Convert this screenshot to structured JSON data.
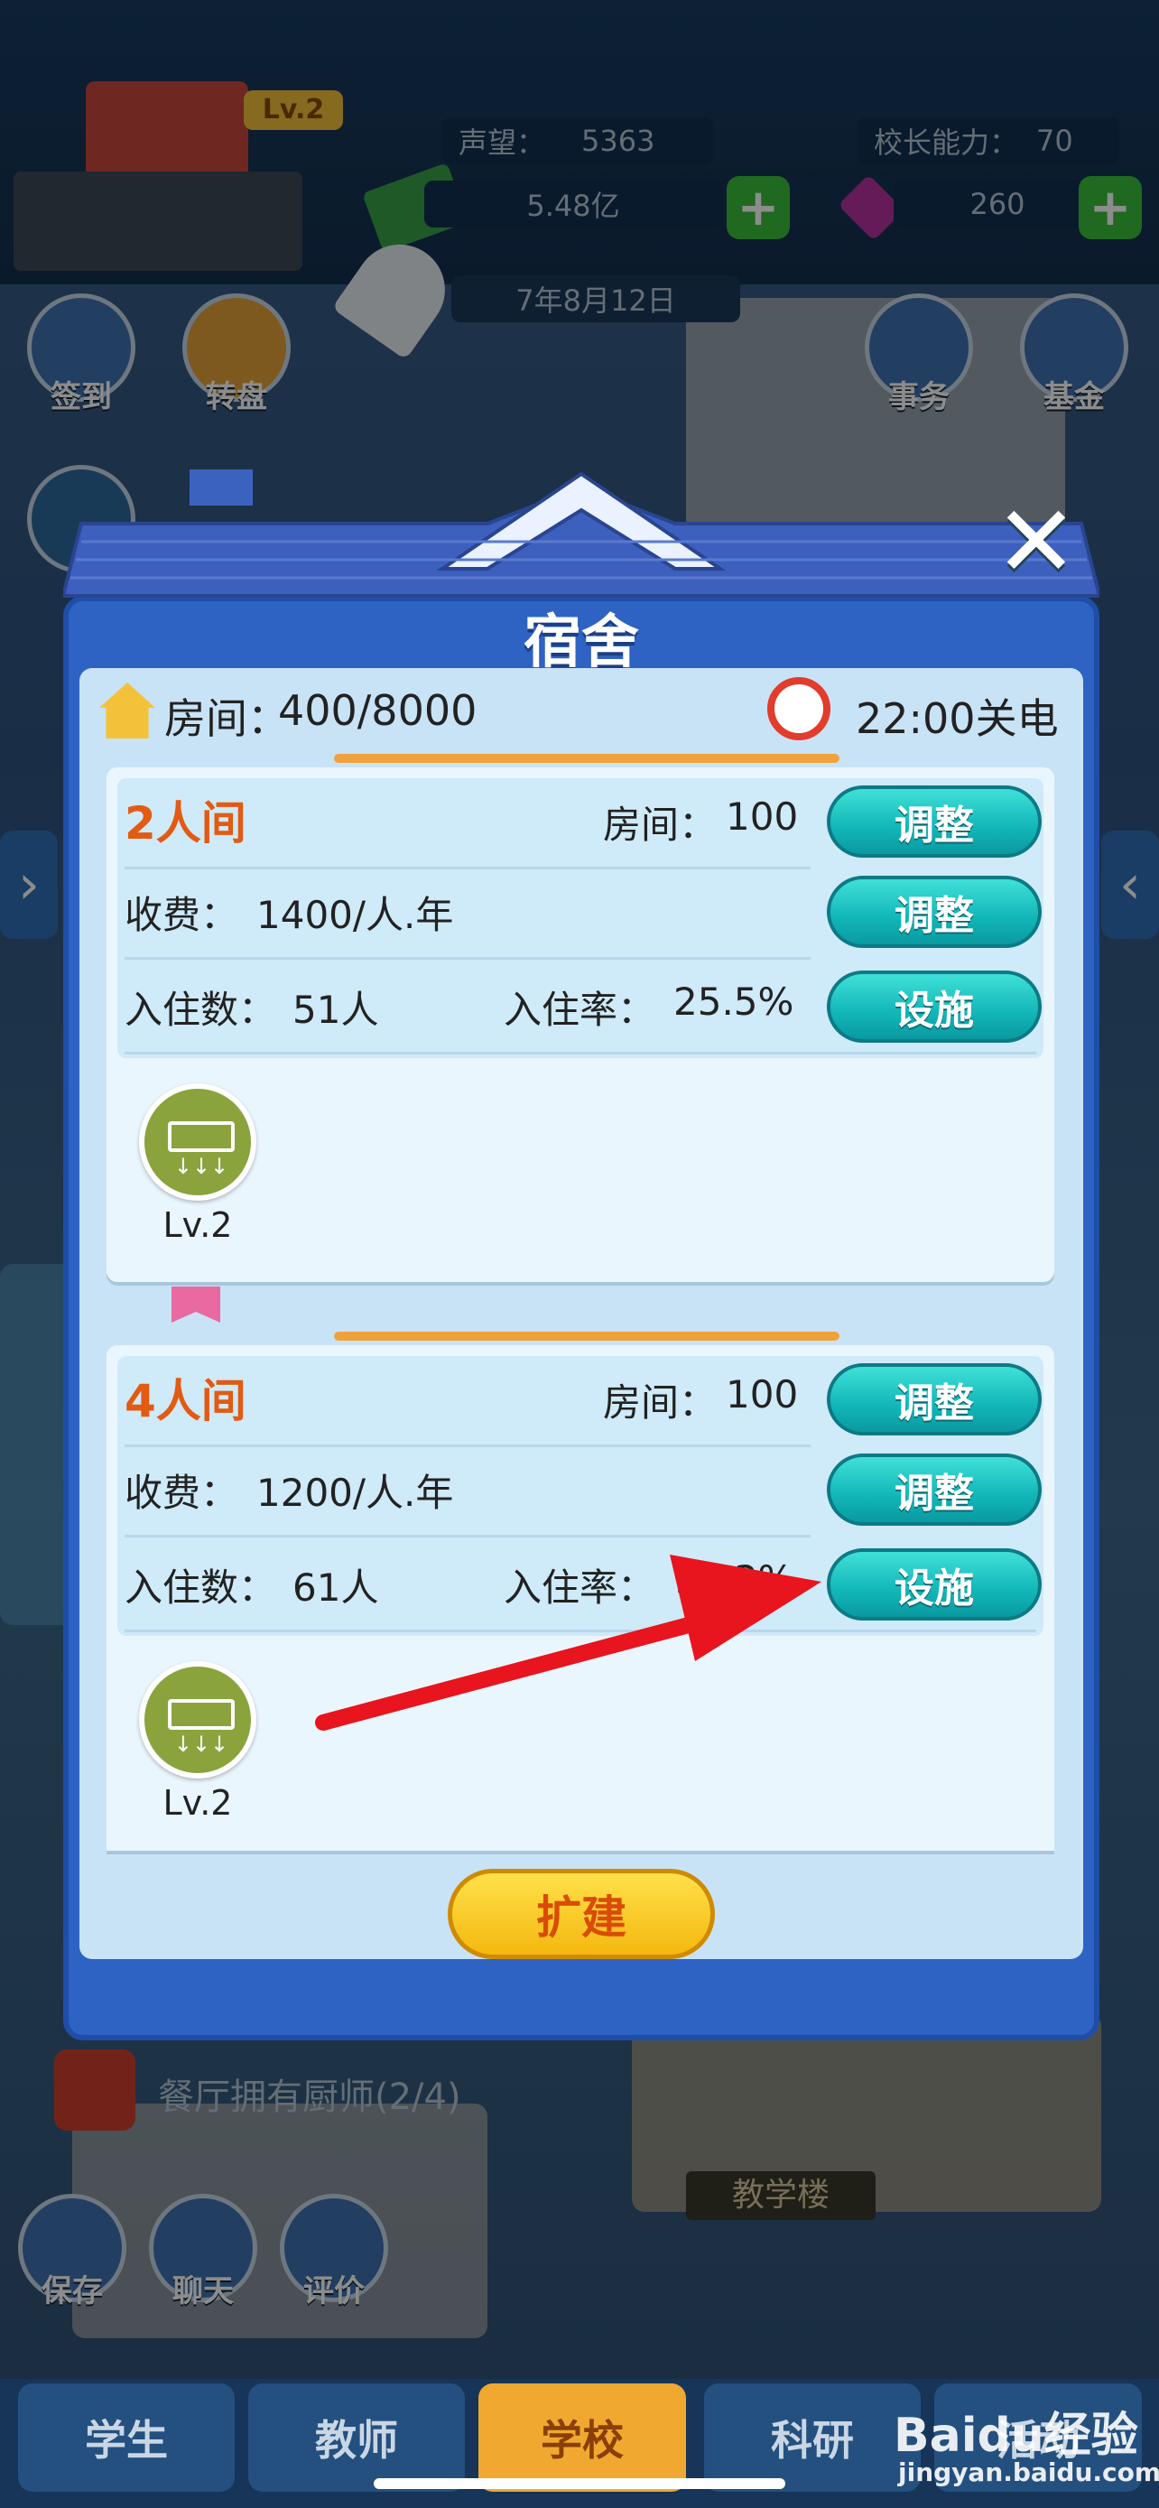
{
  "hud": {
    "school_level": "Lv.2",
    "reputation_label": "声望：",
    "reputation_value": "5363",
    "principal_label": "校长能力：",
    "principal_value": "70",
    "money": "5.48亿",
    "gems": "260",
    "date": "7年8月12日"
  },
  "menu": {
    "checkin": "签到",
    "wheel": "转盘",
    "affairs": "事务",
    "fund": "基金"
  },
  "modal": {
    "title": "宿舍",
    "rooms_label": "房间：",
    "rooms_value": "400/8000",
    "power_off": "22:00关电",
    "dorms": [
      {
        "type": "2人间",
        "rooms_label": "房间：",
        "rooms_value": "100",
        "fee_label": "收费：",
        "fee_value": "1400/人.年",
        "occupants_label": "入住数：",
        "occupants_value": "51人",
        "rate_label": "入住率：",
        "rate_value": "25.5%",
        "btn_adjust_rooms": "调整",
        "btn_adjust_fee": "调整",
        "btn_facility": "设施",
        "facility_level": "Lv.2"
      },
      {
        "type": "4人间",
        "rooms_label": "房间：",
        "rooms_value": "100",
        "fee_label": "收费：",
        "fee_value": "1200/人.年",
        "occupants_label": "入住数：",
        "occupants_value": "61人",
        "rate_label": "入住率：",
        "rate_value": "15.3%",
        "btn_adjust_rooms": "调整",
        "btn_adjust_fee": "调整",
        "btn_facility": "设施",
        "facility_level": "Lv.2"
      }
    ],
    "expand_button": "扩建"
  },
  "background": {
    "notice": "餐厅拥有厨师(2/4)",
    "building_label": "教学楼",
    "save": "保存",
    "chat": "聊天",
    "review": "评价"
  },
  "tabs": [
    {
      "label": "学生",
      "active": false
    },
    {
      "label": "教师",
      "active": false
    },
    {
      "label": "学校",
      "active": true
    },
    {
      "label": "科研",
      "active": false
    },
    {
      "label": "活动",
      "active": false
    }
  ],
  "watermark": {
    "brand": "Baidu经验",
    "url": "jingyan.baidu.com"
  },
  "colors": {
    "accent_teal": "#11b6b8",
    "room_type_orange": "#e35a12",
    "modal_blue": "#2e63c4",
    "expand_yellow": "#f4b80f",
    "arrow_red": "#e8141e"
  }
}
